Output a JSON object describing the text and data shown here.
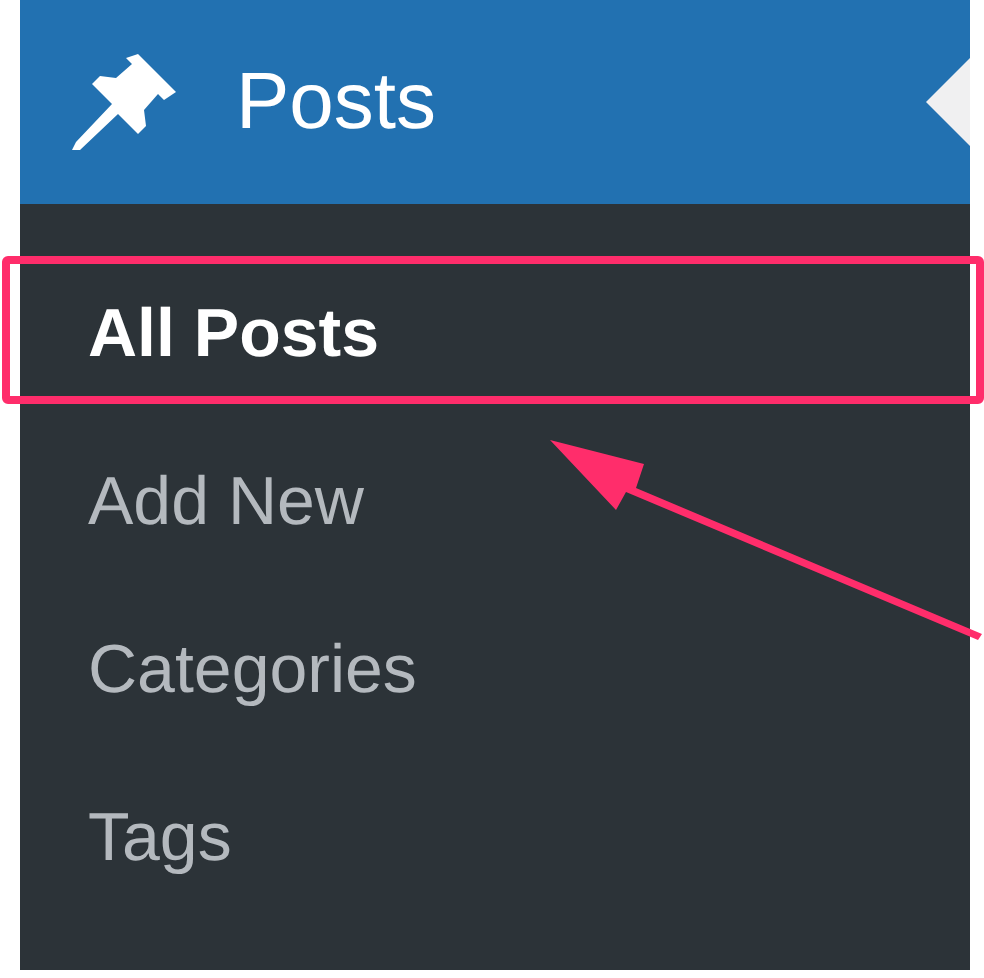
{
  "menu": {
    "title": "Posts",
    "current": true,
    "items": [
      {
        "label": "All Posts",
        "selected": true,
        "highlighted": true
      },
      {
        "label": "Add New",
        "selected": false,
        "highlighted": false
      },
      {
        "label": "Categories",
        "selected": false,
        "highlighted": false
      },
      {
        "label": "Tags",
        "selected": false,
        "highlighted": false
      }
    ]
  },
  "annotation": {
    "arrow": true
  }
}
